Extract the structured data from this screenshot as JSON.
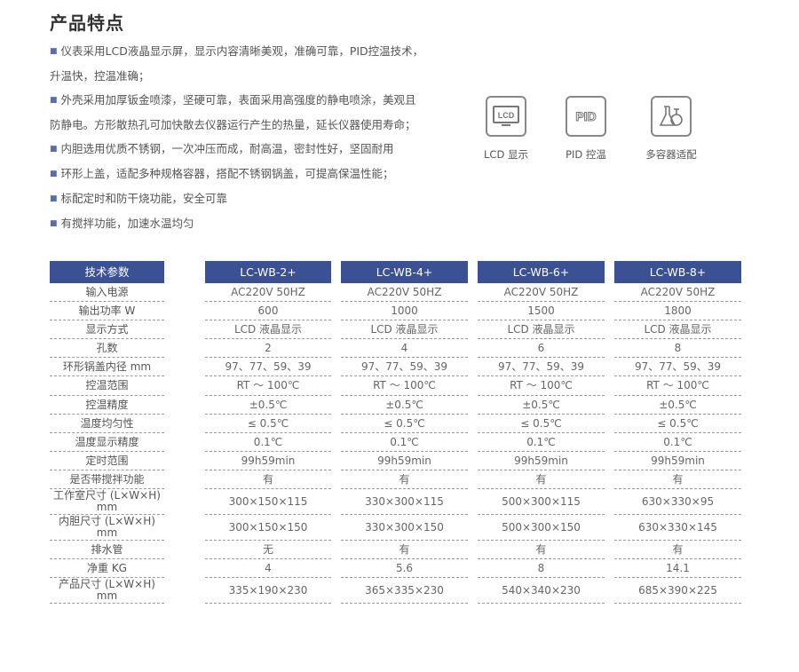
{
  "features": {
    "title": "产品特点",
    "items": [
      {
        "line1": "仪表采用LCD液晶显示屏，显示内容清晰美观，准确可靠，PID控温技术，",
        "line2": "升温快，控温准确；"
      },
      {
        "line1": "外壳采用加厚钣金喷漆，坚硬可靠，表面采用高强度的静电喷涂，美观且",
        "line2": "防静电。方形散热孔可加快散去仪器运行产生的热量，延长仪器使用寿命；"
      },
      {
        "line1": "内胆选用优质不锈钢，一次冲压而成，耐高温，密封性好，坚固耐用",
        "line2": ""
      },
      {
        "line1": "环形上盖，适配多种规格容器，搭配不锈钢锅盖，可提高保温性能；",
        "line2": ""
      },
      {
        "line1": "标配定时和防干烧功能，安全可靠",
        "line2": ""
      },
      {
        "line1": "有搅拌功能，加速水温均匀",
        "line2": ""
      }
    ]
  },
  "icons": [
    {
      "name": "lcd-icon",
      "glyph": "LCD",
      "label": "LCD 显示"
    },
    {
      "name": "pid-icon",
      "glyph": "PID",
      "label": "PID 控温"
    },
    {
      "name": "multi-container-icon",
      "glyph": "",
      "label": "多容器适配"
    }
  ],
  "table": {
    "param_header": "技术参数",
    "params": [
      "输入电源",
      "输出功率 W",
      "显示方式",
      "孔数",
      "环形锅盖内径 mm",
      "控温范围",
      "控温精度",
      "温度均匀性",
      "温度显示精度",
      "定时范围",
      "是否带搅拌功能",
      "工作室尺寸 (L×W×H) mm",
      "内胆尺寸 (L×W×H) mm",
      "排水管",
      "净重 KG",
      "产品尺寸 (L×W×H) mm"
    ],
    "models": [
      {
        "name": "LC-WB-2+",
        "values": [
          "AC220V 50HZ",
          "600",
          "LCD 液晶显示",
          "2",
          "97、77、59、39",
          "RT ～ 100℃",
          "±0.5℃",
          "≤ 0.5℃",
          "0.1℃",
          "99h59min",
          "有",
          "300×150×115",
          "300×150×150",
          "无",
          "4",
          "335×190×230"
        ]
      },
      {
        "name": "LC-WB-4+",
        "values": [
          "AC220V 50HZ",
          "1000",
          "LCD 液晶显示",
          "4",
          "97、77、59、39",
          "RT ～ 100℃",
          "±0.5℃",
          "≤ 0.5℃",
          "0.1℃",
          "99h59min",
          "有",
          "330×300×115",
          "330×300×150",
          "有",
          "5.6",
          "365×335×230"
        ]
      },
      {
        "name": "LC-WB-6+",
        "values": [
          "AC220V 50HZ",
          "1500",
          "LCD 液晶显示",
          "6",
          "97、77、59、39",
          "RT ～ 100℃",
          "±0.5℃",
          "≤ 0.5℃",
          "0.1℃",
          "99h59min",
          "有",
          "500×300×115",
          "500×300×150",
          "有",
          "8",
          "540×340×230"
        ]
      },
      {
        "name": "LC-WB-8+",
        "values": [
          "AC220V 50HZ",
          "1800",
          "LCD 液晶显示",
          "8",
          "97、77、59、39",
          "RT ～ 100℃",
          "±0.5℃",
          "≤ 0.5℃",
          "0.1℃",
          "99h59min",
          "有",
          "630×330×95",
          "630×330×145",
          "有",
          "14.1",
          "685×390×225"
        ]
      }
    ]
  }
}
